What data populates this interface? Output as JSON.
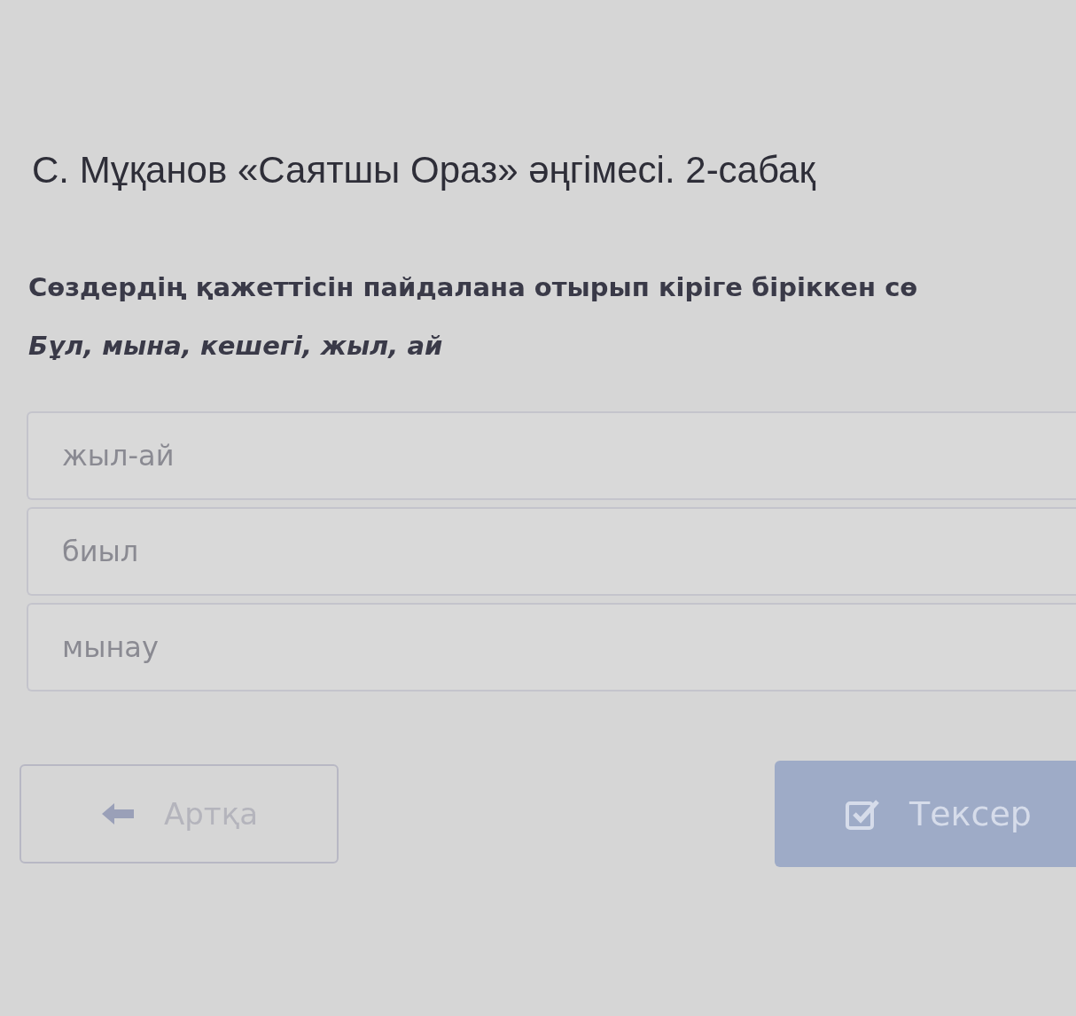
{
  "title": "С. Мұқанов «Саятшы Ораз» әңгімесі. 2-сабақ",
  "question": {
    "instruction": "Сөздердің қажеттісін пайдалана отырып кіріге біріккен сө",
    "words": "Бұл, мына, кешегі, жыл, ай"
  },
  "answers": [
    {
      "value": "жыл-ай"
    },
    {
      "value": "биыл"
    },
    {
      "value": "мынау"
    }
  ],
  "buttons": [
    {
      "kind": "back",
      "label": "Артқа",
      "disabled": true
    },
    {
      "kind": "check",
      "label": "Тексер",
      "disabled": true
    }
  ]
}
